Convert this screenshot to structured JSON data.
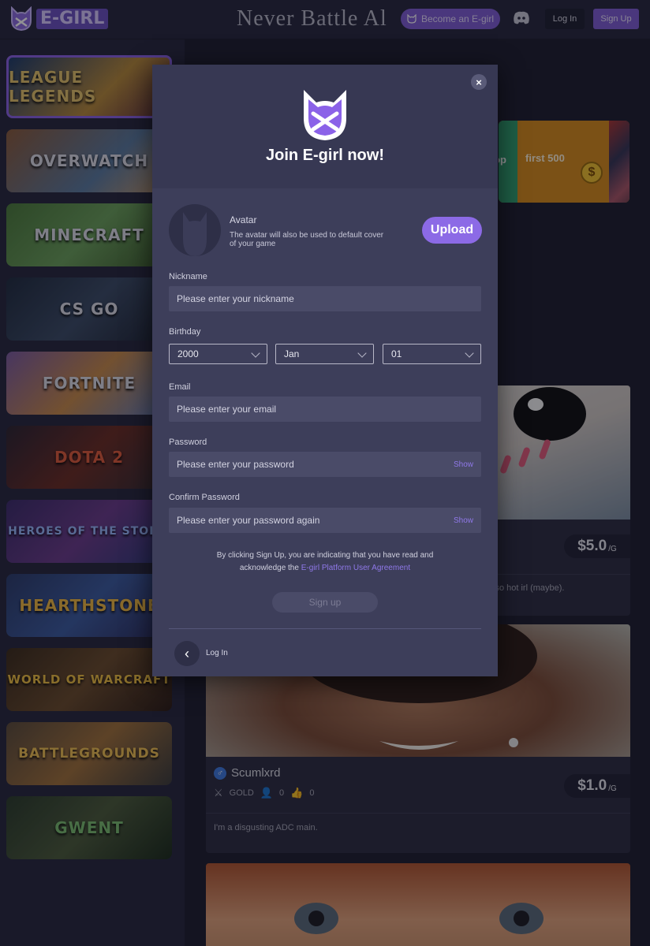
{
  "header": {
    "logo_text": "E-GIRL",
    "banner_text": "Never Battle Al",
    "become_label": "Become an E-girl",
    "login_label": "Log In",
    "signup_label": "Sign Up"
  },
  "sidebar": {
    "games": [
      {
        "label": "LEAGUE LEGENDS"
      },
      {
        "label": "OVERWATCH"
      },
      {
        "label": "MINECRAFT"
      },
      {
        "label": "CS GO"
      },
      {
        "label": "FORTNITE"
      },
      {
        "label": "DOTA 2"
      },
      {
        "label": "HEROES OF THE STORM"
      },
      {
        "label": "HEARTHSTONE"
      },
      {
        "label": "WORLD OF WARCRAFT"
      },
      {
        "label": "BATTLEGROUNDS"
      },
      {
        "label": "GWENT"
      }
    ]
  },
  "promo": {
    "text": "first 500",
    "fragment": "op"
  },
  "cards": [
    {
      "price": "$5.0",
      "unit": "/G",
      "desc": "lso hot irl (maybe)."
    },
    {
      "name": "Scumlxrd",
      "rank": "GOLD",
      "count1": "0",
      "count2": "0",
      "price": "$1.0",
      "unit": "/G",
      "desc": "I'm a disgusting ADC main."
    }
  ],
  "modal": {
    "close": "×",
    "title": "Join E-girl now!",
    "avatar_label": "Avatar",
    "avatar_hint": "The avatar will also be used to default cover of your game",
    "upload_label": "Upload",
    "nickname_label": "Nickname",
    "nickname_placeholder": "Please enter your nickname",
    "birthday_label": "Birthday",
    "year": "2000",
    "month": "Jan",
    "day": "01",
    "email_label": "Email",
    "email_placeholder": "Please enter your email",
    "password_label": "Password",
    "password_placeholder": "Please enter your password",
    "confirm_label": "Confirm Password",
    "confirm_placeholder": "Please enter your password again",
    "show_label": "Show",
    "agree_text_1": "By clicking Sign Up, you are indicating that you have read and",
    "agree_text_2": "acknowledge the",
    "agree_link": "E-girl Platform User Agreement",
    "signup_submit": "Sign up",
    "back_label": "Log In"
  }
}
